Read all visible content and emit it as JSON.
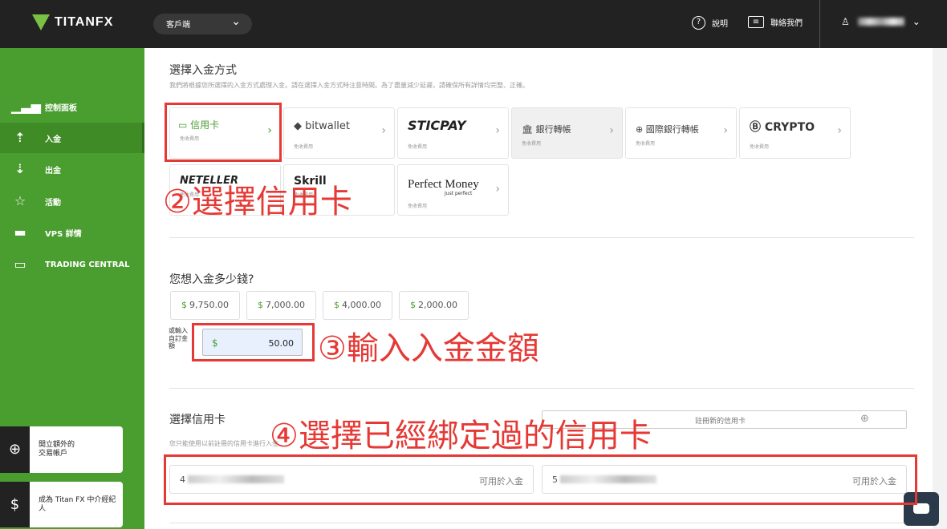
{
  "header": {
    "logo_text": "TITANFX",
    "account_selector": "客戶端",
    "help_label": "說明",
    "contact_label": "聯絡我們"
  },
  "sidebar": {
    "items": [
      {
        "label": "控制面板",
        "icon": "chart-bars-icon"
      },
      {
        "label": "入金",
        "icon": "deposit-icon"
      },
      {
        "label": "出金",
        "icon": "withdraw-icon"
      },
      {
        "label": "活動",
        "icon": "badge-icon"
      },
      {
        "label": "VPS 詳情",
        "icon": "server-icon"
      },
      {
        "label": "TRADING CENTRAL",
        "icon": "monitor-chart-icon"
      }
    ],
    "cards": [
      {
        "label": "開立額外的\n交易帳戶",
        "icon": "plus-circle-icon"
      },
      {
        "label": "成為 Titan FX 中介經紀\n人",
        "icon": "dollar-chat-icon"
      }
    ]
  },
  "payment": {
    "title": "選擇入金方式",
    "note": "我們將根據您所選擇的入金方式處理入金。請在選擇入金方式時注意時間。為了盡量減少延遲，請確保所有詳情均完整、正確。",
    "methods": [
      {
        "name": "信用卡",
        "note": "免收費用"
      },
      {
        "name": "bitwallet",
        "note": "免收費用"
      },
      {
        "name": "STICPAY",
        "note": "免收費用"
      },
      {
        "name": "銀行轉帳",
        "note": "免收費用"
      },
      {
        "name": "國際銀行轉帳",
        "note": "免收費用"
      },
      {
        "name": "CRYPTO",
        "note": "免收費用"
      },
      {
        "name": "NETELLER",
        "note": "免收費用"
      },
      {
        "name": "Skrill",
        "note": "免收費用"
      },
      {
        "name": "Perfect Money",
        "sub": "Just perfect",
        "note": "免收費用"
      }
    ]
  },
  "amount": {
    "title": "您想入金多少錢?",
    "presets": [
      "9,750.00",
      "7,000.00",
      "4,000.00",
      "2,000.00"
    ],
    "currency_symbol": "$",
    "custom_label": "或輸入自訂金額",
    "custom_value": "50.00"
  },
  "card": {
    "title": "選擇信用卡",
    "note": "您只能使用以前註冊的信用卡進行入金",
    "register_label": "註冊新的信用卡",
    "cards": [
      {
        "number_prefix": "4",
        "avail": "可用於入金"
      },
      {
        "number_prefix": "5",
        "avail": "可用於入金"
      }
    ]
  },
  "annotations": {
    "step2": "②選擇信用卡",
    "step3": "③輸入入金金額",
    "step4": "④選擇已經綁定過的信用卡"
  },
  "colors": {
    "brand_green": "#4a9d2f",
    "annotation_red": "#e53935",
    "topbar": "#222222"
  }
}
